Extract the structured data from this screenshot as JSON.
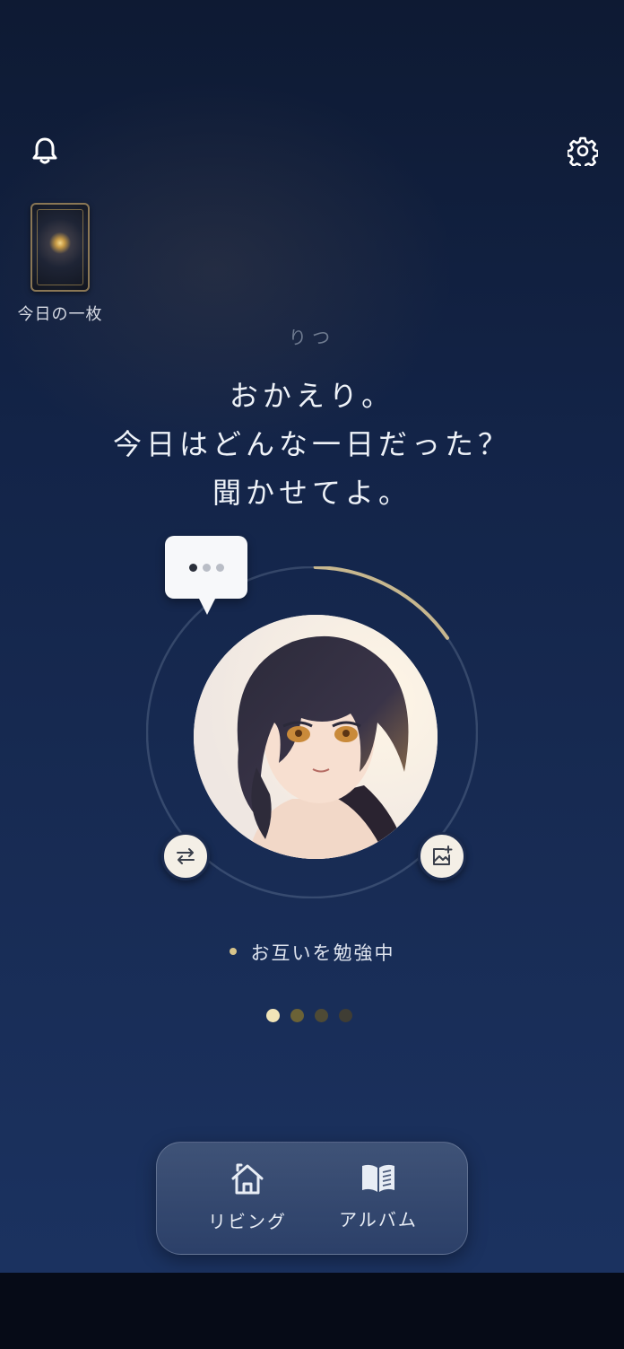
{
  "header": {
    "notification_icon": "bell-icon",
    "settings_icon": "gear-icon"
  },
  "daily_card": {
    "label": "今日の一枚"
  },
  "character": {
    "name": "りつ",
    "greeting_lines": [
      "おかえり。",
      "今日はどんな一日だった？",
      "聞かせてよ。"
    ],
    "typing_indicator_icon": "typing-dots-icon",
    "swap_icon": "swap-arrows-icon",
    "add_photo_icon": "image-add-icon",
    "status": "お互いを勉強中",
    "relationship_progress": 0.15
  },
  "pager": {
    "total": 4,
    "active_index": 0
  },
  "bottom_nav": {
    "items": [
      {
        "label": "リビング",
        "icon": "home-icon"
      },
      {
        "label": "アルバム",
        "icon": "book-icon"
      }
    ]
  },
  "colors": {
    "accent_gold": "#d7c48a",
    "progress_arc": "#c7b78f",
    "background_top": "#0e1a33",
    "background_bottom": "#1b3260"
  }
}
